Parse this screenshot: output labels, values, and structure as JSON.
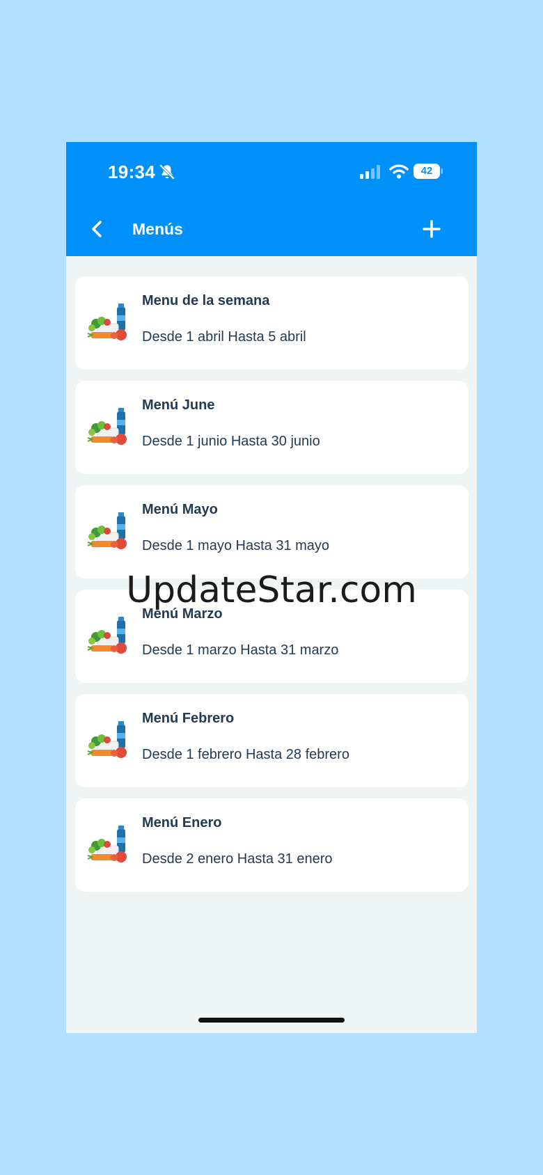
{
  "status_bar": {
    "time": "19:34",
    "battery": "42",
    "icons": [
      "bell-slash-icon",
      "signal-icon",
      "wifi-icon",
      "battery-icon"
    ]
  },
  "header": {
    "title": "Menús",
    "back_icon": "chevron-left-icon",
    "add_icon": "plus-icon"
  },
  "menus": [
    {
      "title": "Menu de la semana",
      "range": "Desde 1 abril Hasta 5 abril"
    },
    {
      "title": "Menú June",
      "range": "Desde 1 junio Hasta 30 junio"
    },
    {
      "title": "Menú Mayo",
      "range": "Desde 1 mayo Hasta 31 mayo"
    },
    {
      "title": "Menú Marzo",
      "range": "Desde 1 marzo Hasta 31 marzo"
    },
    {
      "title": "Menú Febrero",
      "range": "Desde 1 febrero Hasta 28 febrero"
    },
    {
      "title": "Menú Enero",
      "range": "Desde 2 enero Hasta 31 enero"
    }
  ],
  "watermark": "UpdateStar.com",
  "colors": {
    "background": "#b3e0fd",
    "appbar": "#0090fa",
    "content_bg": "#eff4f5",
    "card": "#ffffff",
    "text": "#223b54"
  }
}
